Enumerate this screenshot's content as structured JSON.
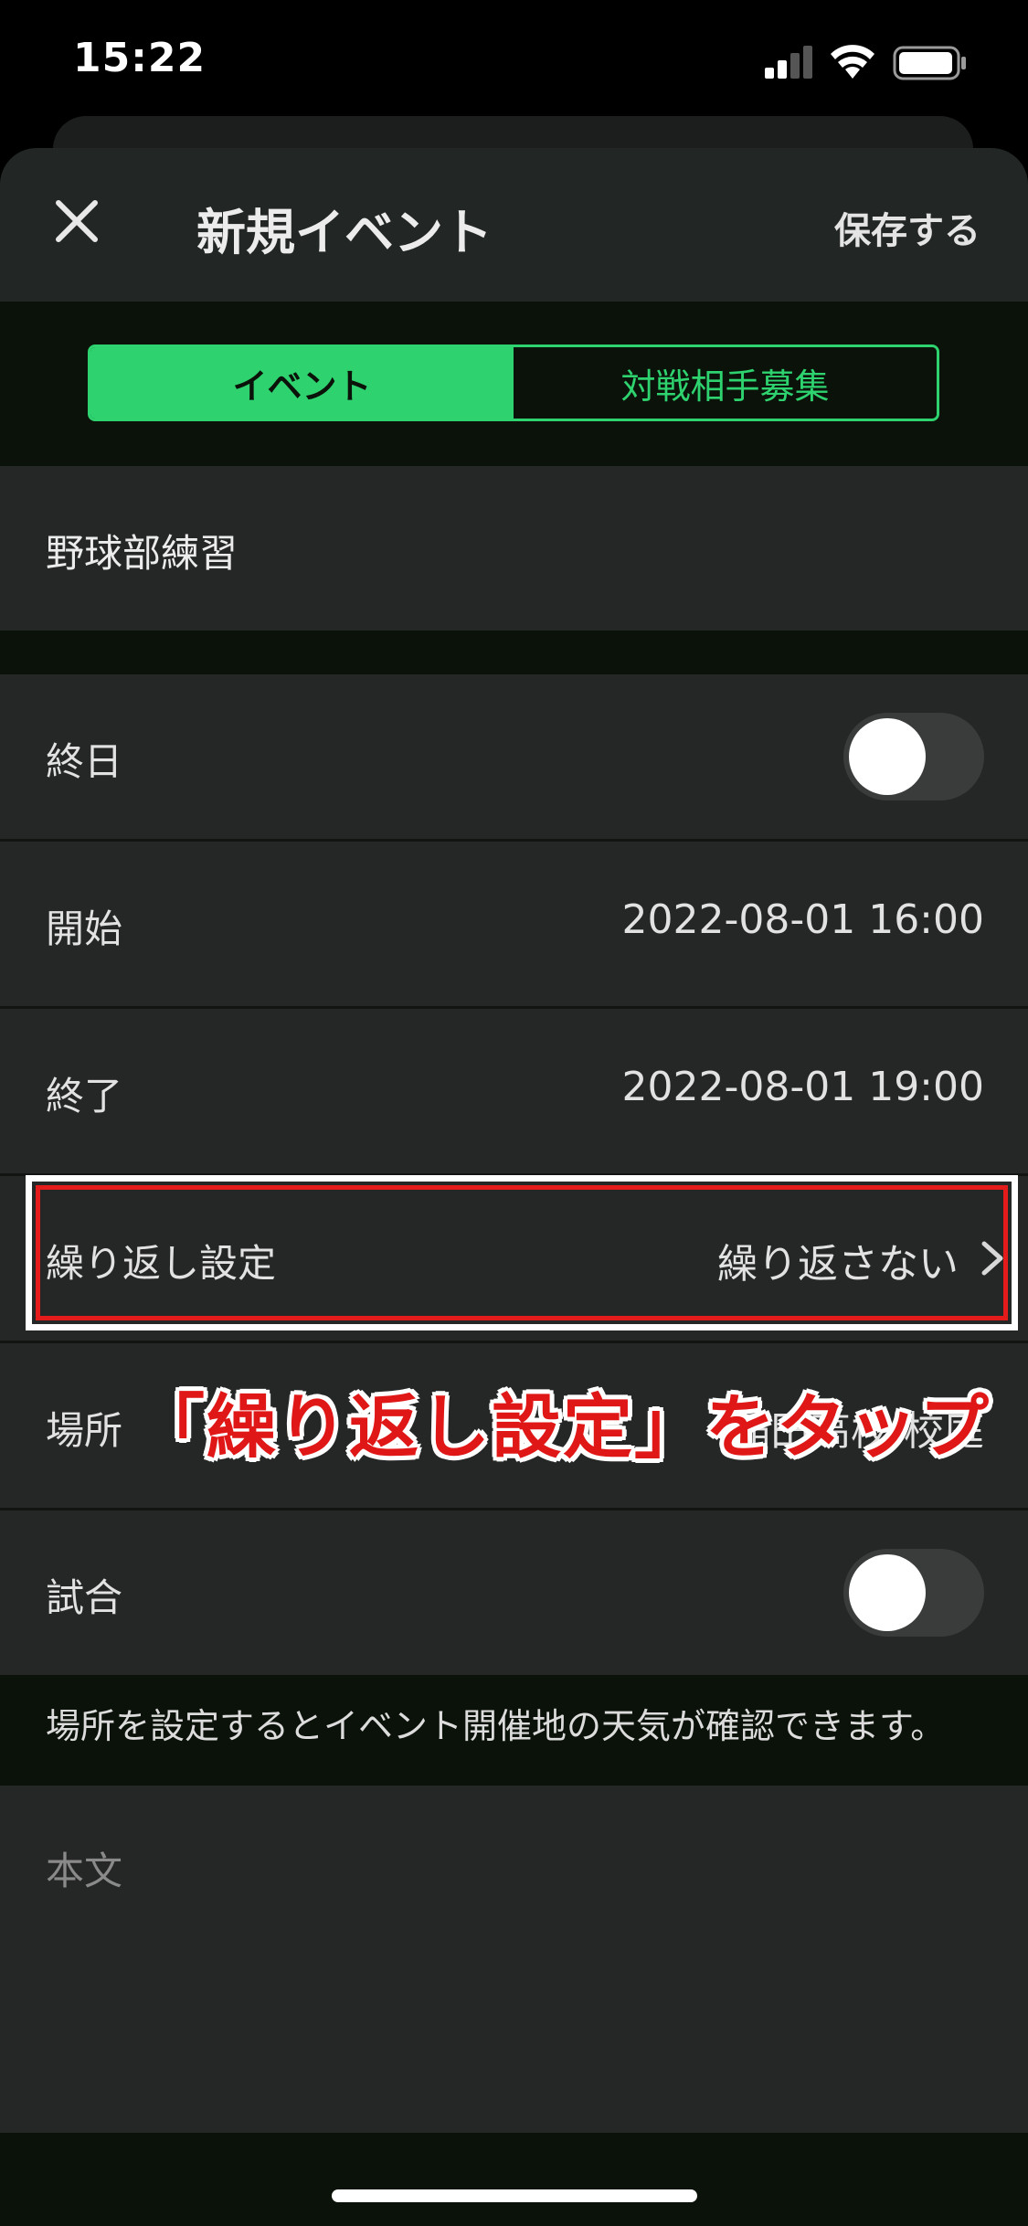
{
  "status_bar": {
    "time": "15:22"
  },
  "nav": {
    "title": "新規イベント",
    "save_label": "保存する"
  },
  "tabs": [
    {
      "label": "イベント",
      "active": true
    },
    {
      "label": "対戦相手募集",
      "active": false
    }
  ],
  "event_title": "野球部練習",
  "rows": {
    "all_day": {
      "label": "終日",
      "toggle_on": false
    },
    "start": {
      "label": "開始",
      "value": "2022-08-01  16:00"
    },
    "end": {
      "label": "終了",
      "value": "2022-08-01  19:00"
    },
    "repeat": {
      "label": "繰り返し設定",
      "value": "繰り返さない"
    },
    "place": {
      "label": "場所",
      "value": "稲田高校 校庭"
    },
    "match": {
      "label": "試合",
      "toggle_on": false
    }
  },
  "info_text": "場所を設定するとイベント開催地の天気が確認できます。",
  "body": {
    "placeholder": "本文"
  },
  "annotation": {
    "callout": "「繰り返し設定」をタップ"
  },
  "colors": {
    "accent": "#2ed36f",
    "annotation_red": "#e31b1b",
    "row_bg": "#252626",
    "sheet_bg": "#0b1209"
  }
}
